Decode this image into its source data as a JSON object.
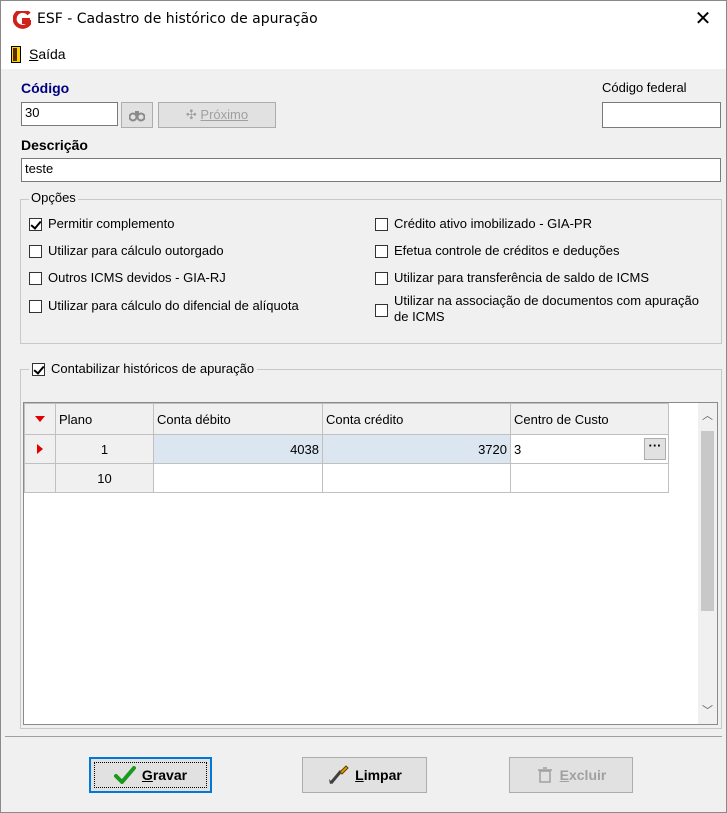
{
  "window": {
    "title": "ESF - Cadastro de histórico de apuração",
    "close_glyph": "✕"
  },
  "menu": {
    "saida_rest": "aída",
    "saida_first": "S"
  },
  "codigo": {
    "label": "Código",
    "value": "30"
  },
  "buttons": {
    "proximo": "Próximo",
    "proximo_icon": "plus-icon"
  },
  "codigo_federal": {
    "label": "Código federal",
    "value": ""
  },
  "descricao": {
    "label": "Descrição",
    "value": "teste"
  },
  "opcoes": {
    "title": "Opções",
    "left": [
      {
        "label": "Permitir complemento",
        "checked": true
      },
      {
        "label": "Utilizar para cálculo outorgado",
        "checked": false
      },
      {
        "label": "Outros ICMS devidos - GIA-RJ",
        "checked": false
      },
      {
        "label": "Utilizar para cálculo do difencial de alíquota",
        "checked": false
      }
    ],
    "right": [
      {
        "label": "Crédito ativo imobilizado - GIA-PR",
        "checked": false
      },
      {
        "label": "Efetua controle de créditos e deduções",
        "checked": false
      },
      {
        "label": "Utilizar para transferência de saldo de ICMS",
        "checked": false
      },
      {
        "label": "Utilizar na associação de documentos com apuração de ICMS",
        "checked": false
      }
    ]
  },
  "contabilizar": {
    "label": "Contabilizar históricos de apuração",
    "checked": true
  },
  "grid": {
    "columns": [
      "Plano",
      "Conta débito",
      "Conta crédito",
      "Centro de Custo"
    ],
    "rows": [
      {
        "plano": "1",
        "debito": "4038",
        "credito": "3720",
        "centro": "3",
        "selected": true
      },
      {
        "plano": "10",
        "debito": "",
        "credito": "",
        "centro": "",
        "selected": false
      }
    ],
    "ellipsis": "···"
  },
  "footer": {
    "gravar_first": "G",
    "gravar_rest": "ravar",
    "limpar_first": "L",
    "limpar_rest": "impar",
    "excluir_first": "E",
    "excluir_rest": "xcluir"
  },
  "colors": {
    "accent_red": "#e00000",
    "label_blue": "#000080",
    "selected_cell": "#dbe6f1"
  }
}
